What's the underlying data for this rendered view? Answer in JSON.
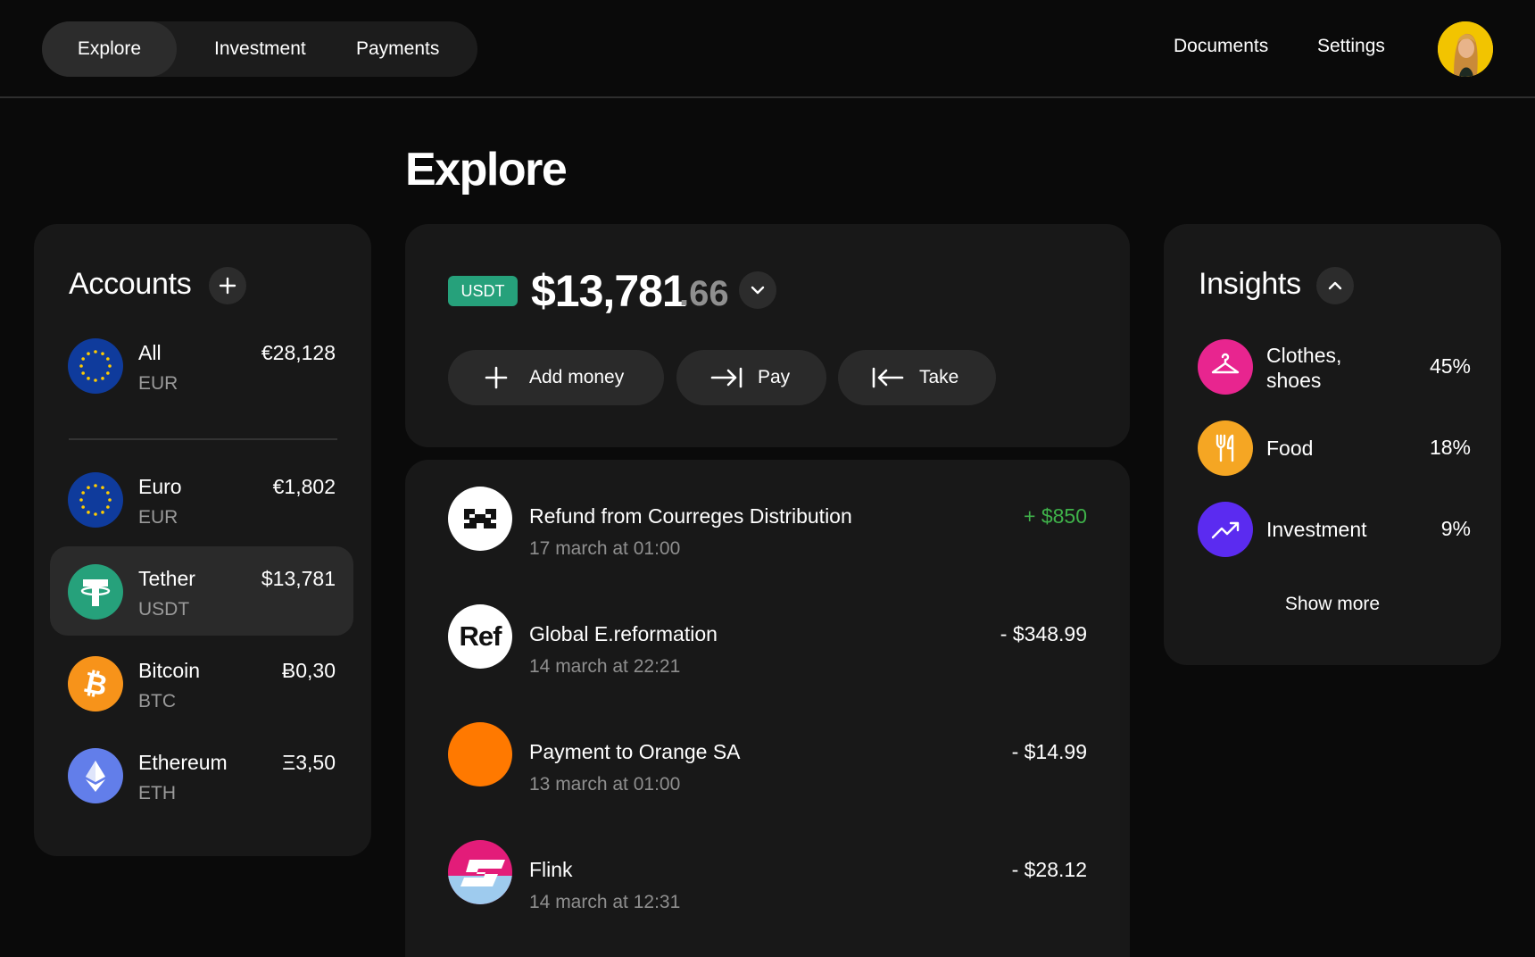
{
  "nav": {
    "tabs": [
      {
        "label": "Explore",
        "active": true
      },
      {
        "label": "Investment",
        "active": false
      },
      {
        "label": "Payments",
        "active": false
      }
    ],
    "links": [
      "Documents",
      "Settings"
    ]
  },
  "page_title": "Explore",
  "accounts": {
    "title": "Accounts",
    "items": [
      {
        "name": "All",
        "code": "EUR",
        "amount": "€28,128",
        "icon": "eu-flag-icon"
      },
      {
        "name": "Euro",
        "code": "EUR",
        "amount": "€1,802",
        "icon": "eu-flag-icon"
      },
      {
        "name": "Tether",
        "code": "USDT",
        "amount": "$13,781",
        "icon": "tether-icon",
        "selected": true
      },
      {
        "name": "Bitcoin",
        "code": "BTC",
        "amount": "Ƀ0,30",
        "icon": "bitcoin-icon"
      },
      {
        "name": "Ethereum",
        "code": "ETH",
        "amount": "Ξ3,50",
        "icon": "ethereum-icon"
      }
    ]
  },
  "balance": {
    "currency_badge": "USDT",
    "amount_main": "$13,781",
    "amount_cents": ".66",
    "actions": [
      "Add money",
      "Pay",
      "Take"
    ]
  },
  "transactions": [
    {
      "title": "Refund from Courreges Distribution",
      "date": "17 march at 01:00",
      "amount": "+ $850",
      "positive": true
    },
    {
      "title": "Global E.reformation",
      "date": "14 march at 22:21",
      "amount": "- $348.99",
      "logo_text": "Ref"
    },
    {
      "title": "Payment to Orange SA",
      "date": "13 march at 01:00",
      "amount": "- $14.99"
    },
    {
      "title": "Flink",
      "date": "14 march at 12:31",
      "amount": "- $28.12"
    }
  ],
  "insights": {
    "title": "Insights",
    "items": [
      {
        "label": "Clothes, shoes",
        "percent": "45%",
        "color": "#e8258f",
        "icon": "hanger-icon"
      },
      {
        "label": "Food",
        "percent": "18%",
        "color": "#f5a623",
        "icon": "fork-knife-icon"
      },
      {
        "label": "Investment",
        "percent": "9%",
        "color": "#5b2bf0",
        "icon": "trend-up-icon"
      }
    ],
    "show_more": "Show more"
  },
  "colors": {
    "background": "#0a0a0a",
    "card": "#181818",
    "accent_green": "#3fb24a",
    "tether_green": "#26a17b",
    "bitcoin_orange": "#f7931a",
    "ethereum_blue": "#627eea",
    "eu_blue": "#0f3b9c"
  }
}
